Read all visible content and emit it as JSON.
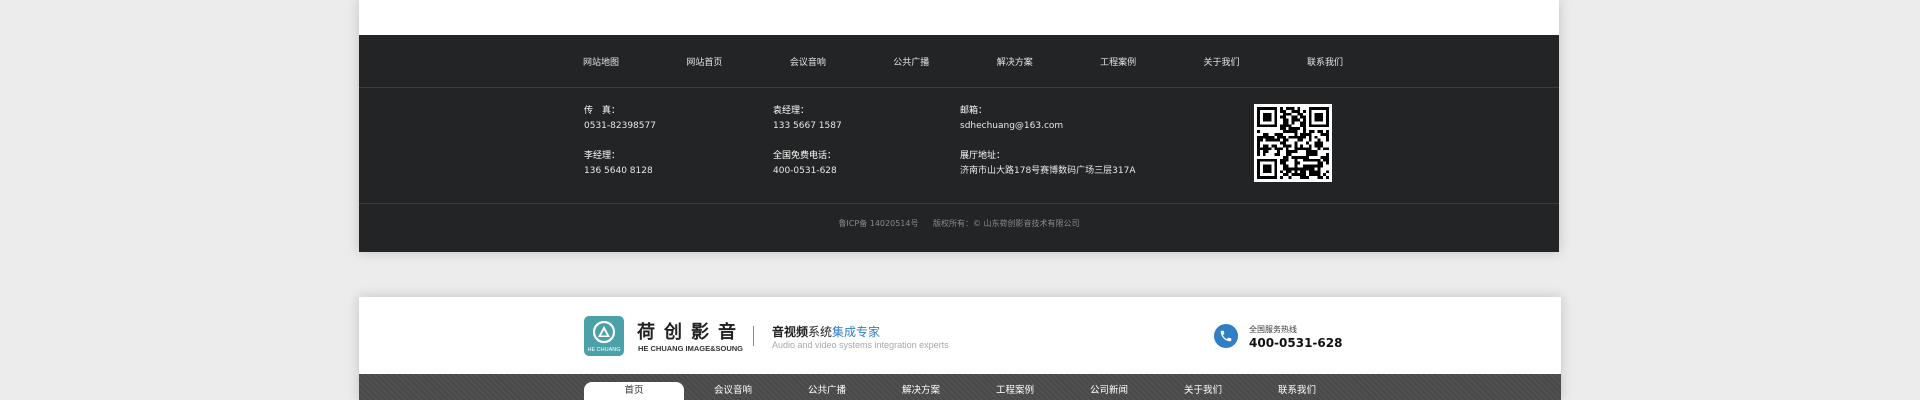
{
  "footer": {
    "nav": [
      "网站地图",
      "网站首页",
      "会议音响",
      "公共广播",
      "解决方案",
      "工程案例",
      "关于我们",
      "联系我们"
    ],
    "contacts": [
      [
        {
          "label": "传　真：",
          "value": "0531-82398577"
        },
        {
          "label": "李经理：",
          "value": "136 5640 8128"
        }
      ],
      [
        {
          "label": "袁经理：",
          "value": "133 5667 1587"
        },
        {
          "label": "全国免费电话：",
          "value": "400-0531-628"
        }
      ],
      [
        {
          "label": "邮箱：",
          "value": "sdhechuang@163.com"
        },
        {
          "label": "展厅地址：",
          "value": "济南市山大路178号赛博数码广场三层317A"
        }
      ]
    ],
    "icp": "鲁ICP备 14020514号",
    "copyright": "版权所有：© 山东荷创影音技术有限公司"
  },
  "header": {
    "logo_text": "HE CHUANG",
    "brand_cn": "荷创影音",
    "brand_en": "HE CHUANG IMAGE&SOUNG",
    "slogan_part1": "音视频",
    "slogan_part2": "系统",
    "slogan_part3": "集成专家",
    "slogan_en": "Audio and video systems integration experts",
    "hotline_label": "全国服务热线",
    "hotline_number": "400-0531-628",
    "nav": [
      "首页",
      "会议音响",
      "公共广播",
      "解决方案",
      "工程案例",
      "公司新闻",
      "关于我们",
      "联系我们"
    ],
    "active_nav": "首页"
  },
  "colors": {
    "footer_bg": "#232425",
    "accent_blue": "#2f7ec6",
    "logo_teal": "#4aa2a8",
    "nav_bar": "#4a4a4a"
  },
  "icons": [
    "logo-mark-icon",
    "qr-code-icon",
    "phone-icon"
  ]
}
